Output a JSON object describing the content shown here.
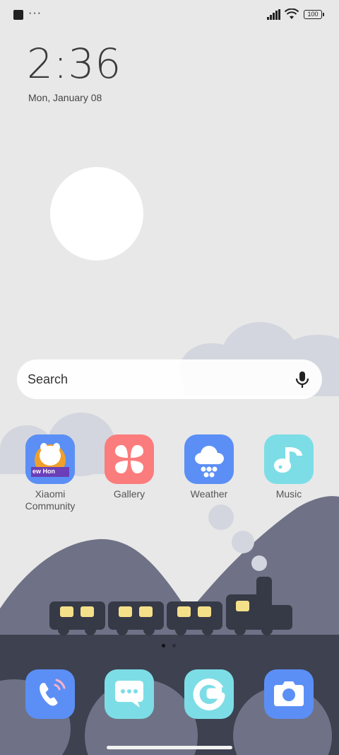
{
  "status_bar": {
    "battery": "100"
  },
  "clock": {
    "time": "2:36",
    "date": "Mon, January 08"
  },
  "search": {
    "placeholder": "Search"
  },
  "apps": [
    {
      "label": "Xiaomi\nCommunity",
      "tile_text": "ew Hon",
      "icon": "xiaomi-community-icon",
      "color": "#5b8ff5"
    },
    {
      "label": "Gallery",
      "icon": "gallery-icon",
      "color": "#fb7c7c"
    },
    {
      "label": "Weather",
      "icon": "weather-icon",
      "color": "#5b8ff5"
    },
    {
      "label": "Music",
      "icon": "music-icon",
      "color": "#7ddde6"
    }
  ],
  "dock": [
    {
      "icon": "phone-icon",
      "color": "#5b8ff5"
    },
    {
      "icon": "messages-icon",
      "color": "#7ddde6"
    },
    {
      "icon": "browser-icon",
      "color": "#7ddde6"
    },
    {
      "icon": "camera-icon",
      "color": "#5b8ff5"
    }
  ],
  "page_indicator": {
    "pages": 2,
    "current": 1
  },
  "colors": {
    "background": "#e8e8e8",
    "mountain": "#6f7286",
    "ground": "#3d4150",
    "train": "#363a46",
    "window": "#f5e08a"
  }
}
